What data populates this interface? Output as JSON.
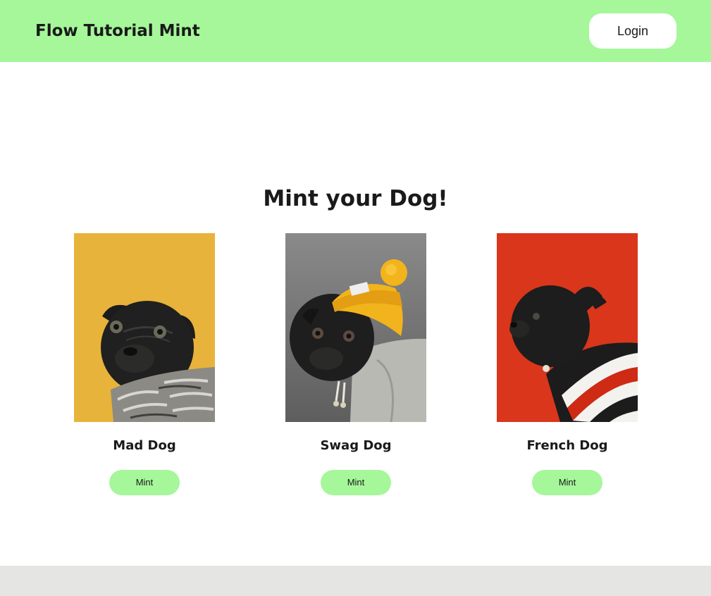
{
  "header": {
    "brand": "Flow Tutorial Mint",
    "login_label": "Login"
  },
  "main": {
    "title": "Mint your Dog!",
    "cards": [
      {
        "name": "Mad Dog",
        "mint_label": "Mint",
        "image_bg": "#e8b33a",
        "image_icon": "pug-scarf-illustration"
      },
      {
        "name": "Swag Dog",
        "mint_label": "Mint",
        "image_bg": "#7a7a7a",
        "image_icon": "pug-beanie-illustration"
      },
      {
        "name": "French Dog",
        "mint_label": "Mint",
        "image_bg": "#d9361c",
        "image_icon": "pug-striped-sweater-illustration"
      }
    ]
  },
  "colors": {
    "accent": "#a5f79a",
    "footer": "#e5e5e3",
    "text": "#1a1a1a"
  }
}
